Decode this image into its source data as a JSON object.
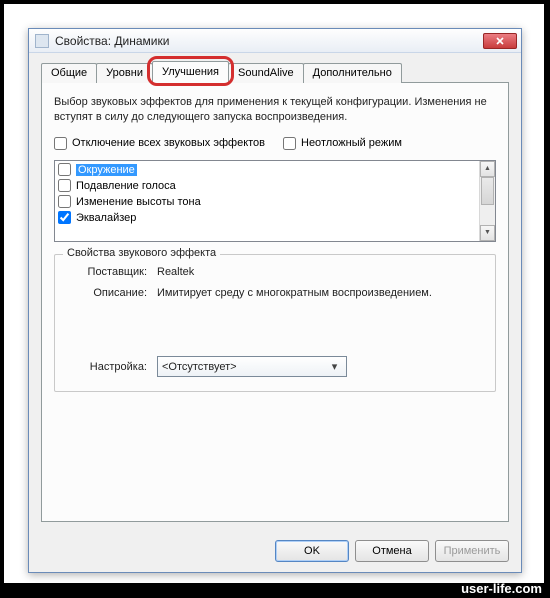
{
  "window": {
    "title": "Свойства: Динамики"
  },
  "tabs": {
    "general": "Общие",
    "levels": "Уровни",
    "enhancements": "Улучшения",
    "soundalive": "SoundAlive",
    "advanced": "Дополнительно"
  },
  "panel": {
    "description": "Выбор звуковых эффектов для применения к текущей конфигурации. Изменения не вступят в силу до следующего запуска воспроизведения.",
    "disable_all": "Отключение всех звуковых эффектов",
    "urgent_mode": "Неотложный режим"
  },
  "effects": [
    {
      "label": "Окружение",
      "checked": false,
      "selected": true
    },
    {
      "label": "Подавление голоса",
      "checked": false,
      "selected": false
    },
    {
      "label": "Изменение высоты тона",
      "checked": false,
      "selected": false
    },
    {
      "label": "Эквалайзер",
      "checked": true,
      "selected": false
    }
  ],
  "group": {
    "title": "Свойства звукового эффекта",
    "vendor_label": "Поставщик:",
    "vendor_value": "Realtek",
    "desc_label": "Описание:",
    "desc_value": "Имитирует среду с многократным воспроизведением.",
    "setting_label": "Настройка:",
    "setting_value": "<Отсутствует>"
  },
  "buttons": {
    "ok": "OK",
    "cancel": "Отмена",
    "apply": "Применить"
  },
  "watermark": "user-life.com"
}
